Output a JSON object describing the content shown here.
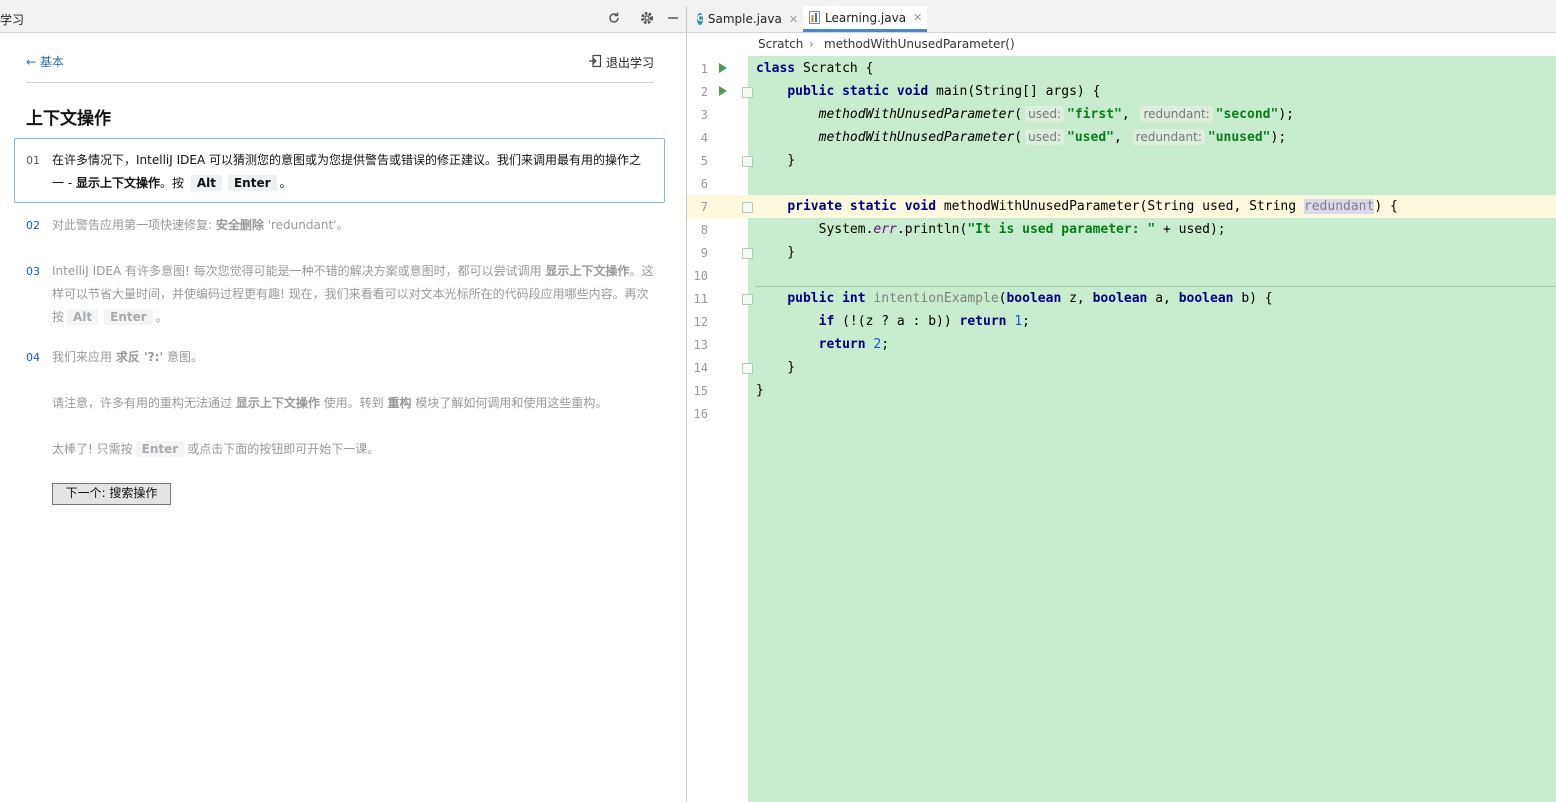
{
  "learn_panel": {
    "title": "学习",
    "back_label": "基本",
    "exit_label": "退出学习",
    "lesson_title": "上下文操作",
    "steps": [
      {
        "num": "01",
        "line1": "在许多情况下，IntelliJ IDEA 可以猜测您的意图或为您提供警告或错误的修正建议。我们来调用最有用的操作之",
        "line2_prefix": "一 - ",
        "line2_bold": "显示上下文操作",
        "line2_mid": "。按",
        "key1": "Alt",
        "key2": "Enter",
        "line2_end": "。"
      },
      {
        "num": "02",
        "prefix": "对此警告应用第一项快速修复: ",
        "bold": "安全删除",
        "suffix": " 'redundant'。"
      },
      {
        "num": "03",
        "line1_pre": "IntelliJ IDEA 有许多意图! 每次您觉得可能是一种不错的解决方案或意图时，都可以尝试调用 ",
        "line1_bold": "显示上下文操作",
        "line1_end": "。这",
        "line2": "样可以节省大量时间，并使编码过程更有趣! 现在，我们来看看可以对文本光标所在的代码段应用哪些内容。再次",
        "line3_pre": "按",
        "key1": "Alt",
        "key2": "Enter",
        "line3_end": "。"
      },
      {
        "num": "04",
        "prefix": "我们来应用 ",
        "bold1": "求反 '?:'",
        "suffix": " 意图。"
      }
    ],
    "note_prefix": "请注意，许多有用的重构无法通过 ",
    "note_bold1": "显示上下文操作",
    "note_mid": " 使用。转到 ",
    "note_bold2": "重构",
    "note_suffix": " 模块了解如何调用和使用这些重构。",
    "final_prefix": "太棒了! 只需按",
    "final_key": "Enter",
    "final_suffix": "或点击下面的按钮即可开始下一课。",
    "next_button": "下一个: 搜索操作"
  },
  "editor": {
    "tabs": [
      {
        "label": "Sample.java",
        "icon": "class-c-icon"
      },
      {
        "label": "Learning.java",
        "icon": "java-file-icon",
        "active": true
      }
    ],
    "breadcrumbs": [
      "Scratch",
      "methodWithUnusedParameter()"
    ],
    "line_numbers": [
      "1",
      "2",
      "3",
      "4",
      "5",
      "6",
      "7",
      "8",
      "9",
      "10",
      "11",
      "12",
      "13",
      "14",
      "15",
      "16"
    ],
    "hints": {
      "used": "used:",
      "redundant": "redundant:"
    },
    "colors": {
      "background": "#c8ecce",
      "current_line": "#fdf9dc",
      "keyword": "#000080",
      "string": "#067d17"
    }
  }
}
